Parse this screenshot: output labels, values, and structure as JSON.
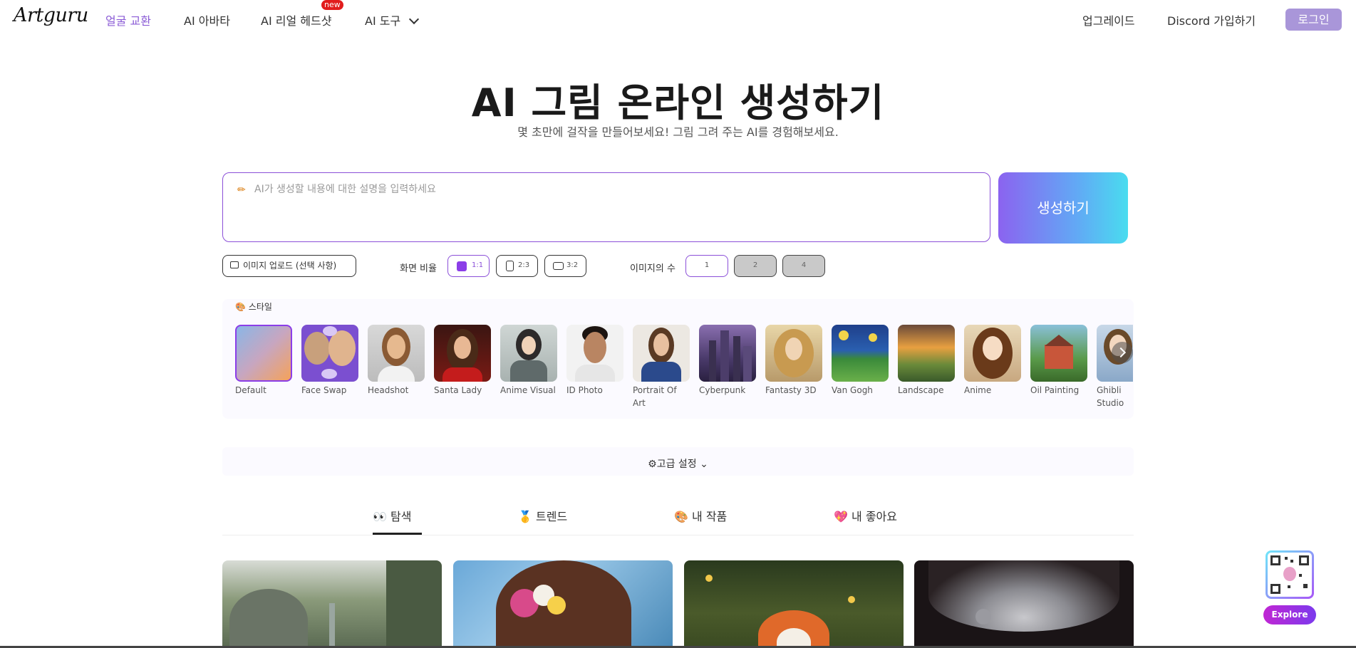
{
  "header": {
    "logo": "Artguru",
    "nav": [
      {
        "label": "얼굴 교환",
        "active": true
      },
      {
        "label": "AI 아바타"
      },
      {
        "label": "AI 리얼 헤드샷",
        "badge": "new"
      },
      {
        "label": "AI 도구"
      }
    ],
    "upgrade": "업그레이드",
    "discord": "Discord 가입하기",
    "login": "로그인"
  },
  "hero": {
    "title": "AI 그림 온라인 생성하기",
    "subtitle": "몇 초만에 걸작을 만들어보세요! 그림 그려 주는 AI를 경험해보세요."
  },
  "prompt": {
    "icon": "pencil-icon",
    "placeholder": "AI가 생성할 내용에 대한 설명을 입력하세요",
    "value": "",
    "generate_label": "생성하기"
  },
  "options": {
    "upload_label": "이미지 업로드 (선택 사항)",
    "ratio_label": "화면 비율",
    "ratios": [
      {
        "label": "1:1",
        "selected": true
      },
      {
        "label": "2:3"
      },
      {
        "label": "3:2"
      }
    ],
    "count_label": "이미지의 수",
    "counts": [
      {
        "label": "1",
        "selected": true
      },
      {
        "label": "2"
      },
      {
        "label": "4"
      }
    ]
  },
  "styles": {
    "header": "스타일",
    "items": [
      {
        "name": "Default",
        "selected": true
      },
      {
        "name": "Face Swap"
      },
      {
        "name": "Headshot"
      },
      {
        "name": "Santa Lady"
      },
      {
        "name": "Anime Visual"
      },
      {
        "name": "ID Photo"
      },
      {
        "name": "Portrait Of Art"
      },
      {
        "name": "Cyberpunk"
      },
      {
        "name": "Fantasty 3D"
      },
      {
        "name": "Van Gogh"
      },
      {
        "name": "Landscape"
      },
      {
        "name": "Anime"
      },
      {
        "name": "Oil Painting"
      },
      {
        "name": "Ghibli Studio"
      }
    ]
  },
  "advanced": {
    "label": "⚙고급 설정 ⌄"
  },
  "tabs": [
    {
      "icon": "👀",
      "label": "탐색",
      "active": true
    },
    {
      "icon": "🥇",
      "label": "트렌드"
    },
    {
      "icon": "🎨",
      "label": "내 작품"
    },
    {
      "icon": "💖",
      "label": "내 좋아요"
    }
  ],
  "explore": {
    "label": "Explore"
  }
}
